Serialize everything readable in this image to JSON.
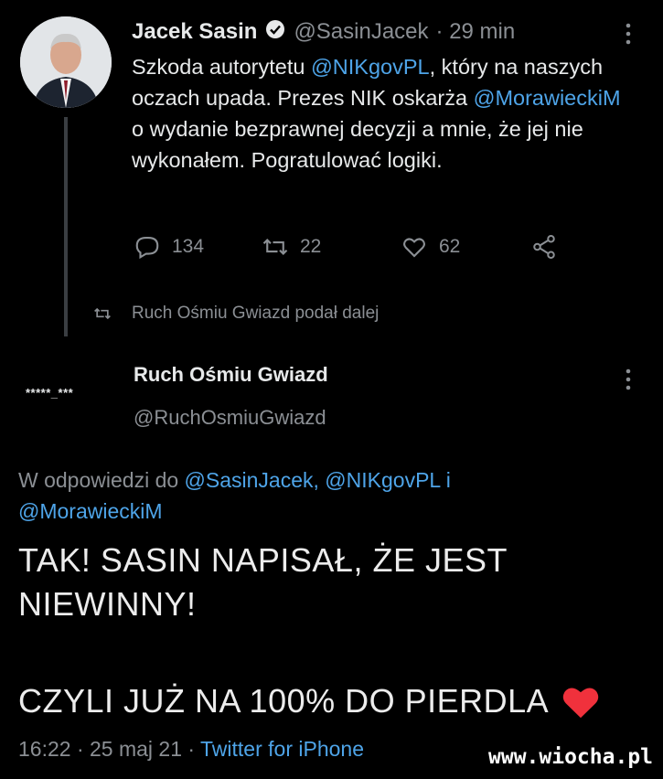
{
  "tweet1": {
    "name": "Jacek Sasin",
    "handle": "@SasinJacek",
    "time": "· 29 min",
    "text": {
      "p1": "Szkoda autorytetu ",
      "mention1": "@NIKgovPL",
      "p2": ", który na naszych oczach upada. Prezes NIK oskarża ",
      "mention2": "@MorawieckiM",
      "p3": " o wydanie bezprawnej decyzji a mnie, że jej nie wykonałem. Pogratulować logiki."
    },
    "replies": "134",
    "retweets": "22",
    "likes": "62",
    "icons": [
      "verified-badge-icon",
      "more-icon",
      "reply-icon",
      "retweet-icon",
      "like-icon",
      "share-icon"
    ]
  },
  "retweet_notice": "Ruch Ośmiu Gwiazd podał dalej",
  "tweet2": {
    "name": "Ruch Ośmiu Gwiazd",
    "handle": "@RuchOsmiuGwiazd",
    "avatar_text": "*****_***",
    "reply_to": {
      "prefix": "W odpowiedzi do ",
      "m1": "@SasinJacek",
      "sep": ", ",
      "m2": "@NIKgovPL",
      "and": " i",
      "m3": "@MorawieckiM"
    },
    "line1": "TAK! SASIN NAPISAŁ, ŻE JEST",
    "line2": "NIEWINNY!",
    "line3": "CZYLI JUŻ NA 100% DO PIERDLA",
    "date": "16:22 · 25 maj 21 · ",
    "source": "Twitter for iPhone"
  },
  "watermark": "www.wiocha.pl",
  "colors": {
    "background": "#000000",
    "link": "#4ea4e8",
    "muted": "#8b8f94",
    "heart": "#f0313c"
  }
}
